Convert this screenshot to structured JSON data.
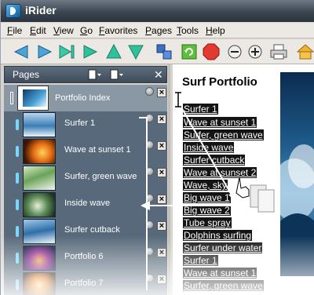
{
  "app": {
    "title": "iRider"
  },
  "menu": [
    "File",
    "Edit",
    "View",
    "Go",
    "Favorites",
    "Pages",
    "Tools",
    "Help"
  ],
  "toolbar": {
    "icons": [
      "back-arrow-icon",
      "forward-arrow-icon",
      "play-icon",
      "go-icon",
      "up-icon",
      "down-icon",
      "tile-windows-icon",
      "refresh-icon",
      "stop-icon",
      "zoom-out-icon",
      "zoom-in-icon",
      "print-icon",
      "home-icon"
    ]
  },
  "sidebar": {
    "title": "Pages",
    "close": "✕",
    "index_item": {
      "label": "Portfolio Index"
    },
    "items": [
      {
        "label": "Surfer 1"
      },
      {
        "label": "Wave at sunset 1"
      },
      {
        "label": "Surfer, green wave"
      },
      {
        "label": "Inside wave"
      },
      {
        "label": "Surfer cutback"
      },
      {
        "label": "Portfolio 6"
      },
      {
        "label": "Portfolio 7"
      }
    ]
  },
  "content": {
    "title": "Surf Portfolio",
    "links": [
      "Surfer 1",
      "Wave at sunset 1",
      "Surfer, green wave",
      "Inside wave",
      "Surfer cutback",
      "Wave at sunset 2",
      "Wave, sky",
      "Big wave 1",
      "Big wave 2",
      "Tube spray",
      "Dolphins surfing",
      "Surfer under water",
      "Surfer 1",
      "Wave at sunset 1",
      "Surfer, green wave"
    ]
  },
  "colors": {
    "accent": "#7ad7ff",
    "sidebar_bg": "#57697a",
    "titlebar": "#3b4652",
    "link_bg": "#141414"
  }
}
